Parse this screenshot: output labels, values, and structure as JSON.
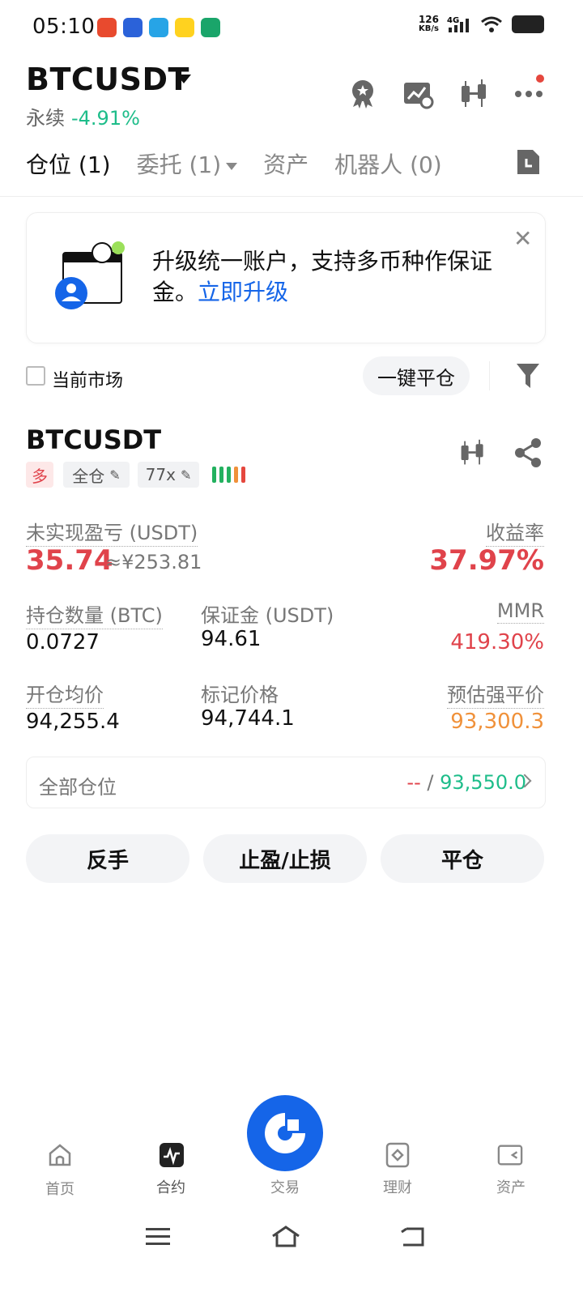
{
  "status_bar": {
    "time": "05:10",
    "net_speed_value": "126",
    "net_speed_unit": "KB/s",
    "net_type": "4G"
  },
  "header": {
    "symbol": "BTCUSDT",
    "contract_type": "永续",
    "change": "-4.91%"
  },
  "tabs": [
    {
      "label": "仓位 (1)"
    },
    {
      "label": "委托 (1)"
    },
    {
      "label": "资产"
    },
    {
      "label": "机器人 (0)"
    }
  ],
  "banner": {
    "text": "升级统一账户，支持多币种作保证金。",
    "link": "立即升级"
  },
  "filters": {
    "current_market": "当前市场",
    "close_all": "一键平仓"
  },
  "position": {
    "symbol": "BTCUSDT",
    "side": "多",
    "margin_mode": "全仓",
    "leverage": "77x",
    "unrealized_pnl_label": "未实现盈亏 (USDT)",
    "unrealized_pnl": "35.74",
    "unrealized_pnl_fiat": "≈¥253.81",
    "roe_label": "收益率",
    "roe": "37.97%",
    "size_label": "持仓数量 (BTC)",
    "size": "0.0727",
    "margin_label": "保证金 (USDT)",
    "margin": "94.61",
    "mmr_label": "MMR",
    "mmr": "419.30%",
    "entry_price_label": "开仓均价",
    "entry_price": "94,255.4",
    "mark_price_label": "标记价格",
    "mark_price": "94,744.1",
    "liq_price_label": "预估强平价",
    "liq_price": "93,300.3",
    "all_positions_label": "全部仓位",
    "all_positions_left": "--",
    "all_positions_sep": "/",
    "all_positions_right": "93,550.0"
  },
  "actions": {
    "reverse": "反手",
    "tpsl": "止盈/止损",
    "close": "平仓"
  },
  "bottom_nav": [
    {
      "label": "首页"
    },
    {
      "label": "合约"
    },
    {
      "label": "交易"
    },
    {
      "label": "理财"
    },
    {
      "label": "资产"
    }
  ],
  "colors": {
    "accent": "#1565e8",
    "up": "#1ebd8a",
    "down": "#e0434b",
    "warn": "#f0913a"
  }
}
